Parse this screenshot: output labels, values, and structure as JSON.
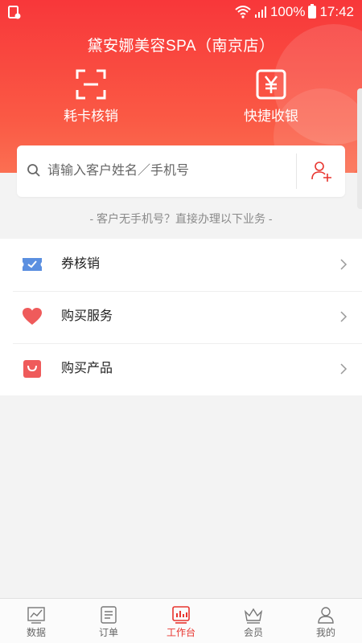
{
  "status_bar": {
    "battery": "100%",
    "time": "17:42"
  },
  "header": {
    "store_name": "黛安娜美容SPA（南京店）",
    "actions": [
      {
        "label": "耗卡核销",
        "icon": "scan-icon"
      },
      {
        "label": "快捷收银",
        "icon": "yen-icon"
      }
    ]
  },
  "search": {
    "placeholder": "请输入客户姓名／手机号",
    "value": ""
  },
  "hint": "- 客户无手机号？直接办理以下业务 -",
  "menu": {
    "items": [
      {
        "label": "券核销",
        "icon": "coupon-icon",
        "color": "#5b8fe0"
      },
      {
        "label": "购买服务",
        "icon": "heart-icon",
        "color": "#ef5b5b"
      },
      {
        "label": "购买产品",
        "icon": "shopping-bag-icon",
        "color": "#ef5b5b"
      }
    ]
  },
  "tabbar": {
    "active": "工作台",
    "items": [
      {
        "label": "数据",
        "icon": "chart-icon"
      },
      {
        "label": "订单",
        "icon": "list-icon"
      },
      {
        "label": "工作台",
        "icon": "workbench-icon"
      },
      {
        "label": "会员",
        "icon": "crown-icon"
      },
      {
        "label": "我的",
        "icon": "profile-icon"
      }
    ]
  },
  "colors": {
    "brand": "#f8373a",
    "active_tab": "#e8342e"
  }
}
